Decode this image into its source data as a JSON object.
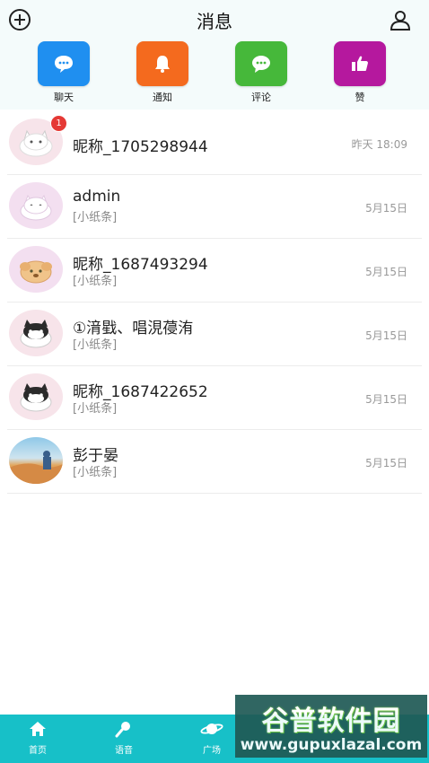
{
  "header": {
    "title": "消息"
  },
  "categories": [
    {
      "label": "聊天",
      "icon": "chat-bubble-icon",
      "color": "#1f8ff0"
    },
    {
      "label": "通知",
      "icon": "bell-icon",
      "color": "#f46a1e"
    },
    {
      "label": "评论",
      "icon": "comment-icon",
      "color": "#46b83a"
    },
    {
      "label": "赞",
      "icon": "thumbs-up-icon",
      "color": "#b5189e"
    }
  ],
  "messages": [
    {
      "name": "昵称_1705298944",
      "preview": "",
      "time": "昨天 18:09",
      "badge": "1",
      "avatar": "cat-white"
    },
    {
      "name": "admin",
      "preview": "[小纸条]",
      "time": "5月15日",
      "badge": "",
      "avatar": "cat-pink"
    },
    {
      "name": "昵称_1687493294",
      "preview": "[小纸条]",
      "time": "5月15日",
      "badge": "",
      "avatar": "dog-orange"
    },
    {
      "name": "①湇戥、唱涀葠洧",
      "preview": "[小纸条]",
      "time": "5月15日",
      "badge": "",
      "avatar": "cat-black"
    },
    {
      "name": "昵称_1687422652",
      "preview": "[小纸条]",
      "time": "5月15日",
      "badge": "",
      "avatar": "cat-black"
    },
    {
      "name": "彭于晏",
      "preview": "[小纸条]",
      "time": "5月15日",
      "badge": "",
      "avatar": "desert-photo"
    }
  ],
  "tabbar": {
    "tabs": [
      {
        "label": "首页",
        "icon": "home-icon"
      },
      {
        "label": "语音",
        "icon": "microphone-icon"
      },
      {
        "label": "广场",
        "icon": "planet-icon"
      }
    ]
  },
  "watermark": {
    "top": "谷普软件园",
    "bottom": "www.gupuxlazal.com"
  }
}
